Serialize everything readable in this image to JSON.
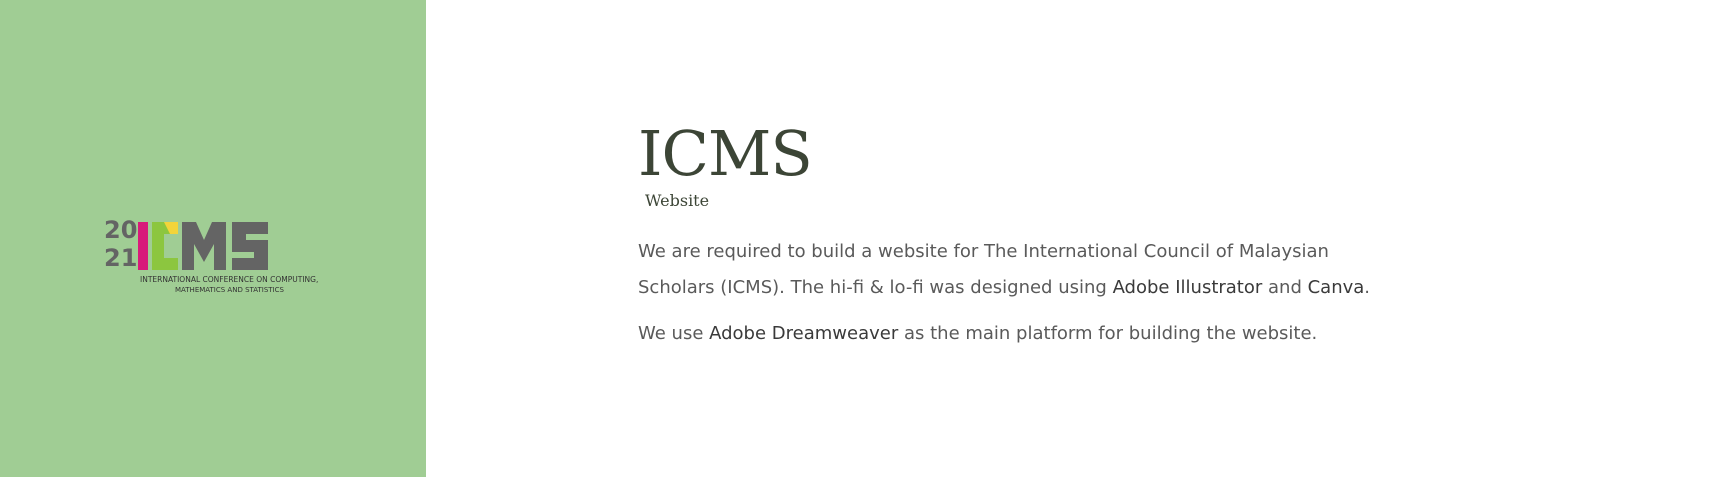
{
  "left_panel": {
    "background": "#a0cd94",
    "logo": {
      "year_top": "20",
      "year_bottom": "21",
      "wordmark": "ICMS",
      "caption_line1": "INTERNATIONAL CONFERENCE ON COMPUTING,",
      "caption_line2": "MATHEMATICS AND STATISTICS"
    }
  },
  "project": {
    "title": "ICMS",
    "subtitle": "Website",
    "para1": {
      "lead": "We are required to build a website for The International Council of Malaysian Scholars (ICMS). The hi-fi & lo-fi was designed using ",
      "tool1": "Adobe Illustrator",
      "conj": " and ",
      "tool2": "Canva",
      "end": "."
    },
    "para2": {
      "lead": "We use ",
      "tool": "Adobe Dreamweaver",
      "end": " as the main platform for building the website."
    }
  },
  "colors": {
    "heading": "#3c4536",
    "body_text": "#5a5a5a",
    "logo_gray": "#646464",
    "logo_magenta": "#d81b7a",
    "logo_yellow": "#f2d43a",
    "logo_green": "#8cc63f"
  }
}
